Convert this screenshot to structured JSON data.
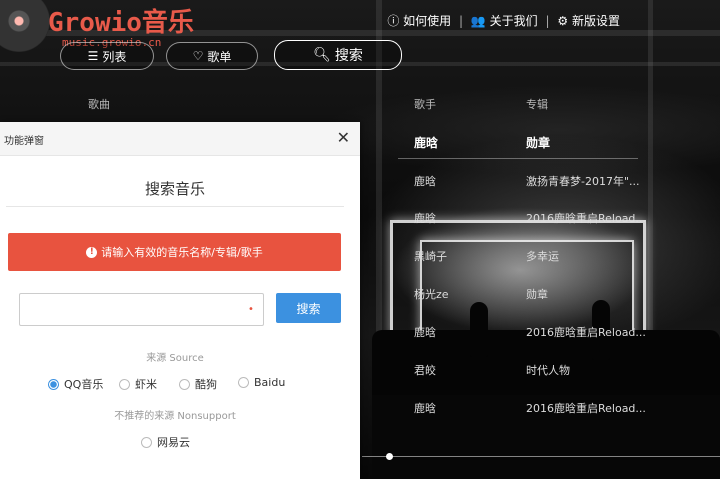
{
  "header": {
    "logo_title": "Growio音乐",
    "logo_subtitle": "music.growio.cn",
    "top_links": [
      {
        "icon": "help-icon",
        "label": "如何使用"
      },
      {
        "icon": "people-icon",
        "label": "关于我们"
      },
      {
        "icon": "gear-icon",
        "label": "新版设置"
      }
    ],
    "pills": {
      "list_label": "列表",
      "playlist_label": "歌单",
      "search_label": "搜索"
    }
  },
  "song_table": {
    "columns": [
      "歌曲",
      "歌手",
      "专辑"
    ],
    "rows": [
      {
        "artist": "鹿晗",
        "album": "勋章"
      },
      {
        "artist": "鹿晗",
        "album": "激扬青春梦-2017年\"..."
      },
      {
        "artist": "鹿晗",
        "album": "2016鹿晗重启Reload..."
      },
      {
        "artist": "黑崎子",
        "album": "多幸运"
      },
      {
        "artist": "杨光ze",
        "album": "勋章"
      },
      {
        "artist": "鹿晗",
        "album": "2016鹿晗重启Reload..."
      },
      {
        "artist": "君皎",
        "album": "时代人物"
      },
      {
        "artist": "鹿晗",
        "album": "2016鹿晗重启Reload..."
      }
    ]
  },
  "dialog": {
    "title": "功能弹窗",
    "close_symbol": "✕",
    "heading": "搜索音乐",
    "alert_text": "请输入有效的音乐名称/专辑/歌手",
    "search_value": "",
    "search_placeholder": "",
    "required_mark": "•",
    "search_button": "搜索",
    "source_label": "来源 Source",
    "sources": [
      {
        "label": "QQ音乐",
        "selected": true
      },
      {
        "label": "虾米",
        "selected": false
      },
      {
        "label": "酷狗",
        "selected": false
      },
      {
        "label": "Baidu",
        "selected": false
      }
    ],
    "nonsupport_label": "不推荐的来源 Nonsupport",
    "nonsupport_sources": [
      {
        "label": "网易云",
        "selected": false
      }
    ]
  },
  "colors": {
    "brand": "#e85a4a",
    "alert": "#e8533f",
    "button": "#3c91e0"
  }
}
